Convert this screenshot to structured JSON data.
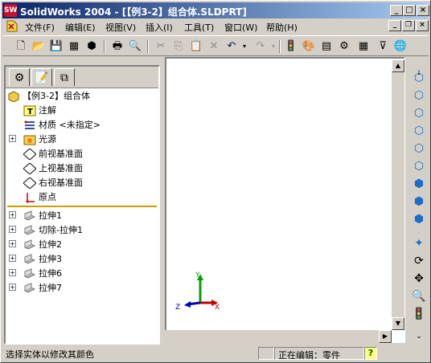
{
  "window": {
    "title": "SolidWorks 2004 - [【例3-2】组合体.SLDPRT]",
    "app_icon_label": "SW",
    "controls": {
      "minimize": "_",
      "maximize": "□",
      "close": "×"
    }
  },
  "menu": {
    "items": [
      "文件(F)",
      "编辑(E)",
      "视图(V)",
      "插入(I)",
      "工具(T)",
      "窗口(W)",
      "帮助(H)"
    ],
    "doc_controls": {
      "minimize": "_",
      "restore": "❐",
      "close": "×"
    }
  },
  "toolbar": {
    "icons": [
      "new-icon",
      "open-icon",
      "save-icon",
      "make-drawing-icon",
      "make-assembly-icon",
      "print-icon",
      "print-preview-icon",
      "cut-icon",
      "copy-icon",
      "paste-icon",
      "delete-icon",
      "undo-icon",
      "redo-icon",
      "traffic-light-icon",
      "edit-color-icon",
      "appearance-icon",
      "grid-icon",
      "options-icon",
      "web-icon"
    ]
  },
  "feature_manager": {
    "tabs": [
      "feature-manager-tab",
      "property-manager-tab",
      "configuration-manager-tab"
    ],
    "root": "【例3-2】组合体",
    "nodes": [
      {
        "label": "注解",
        "icon": "annotation-icon",
        "expand": false
      },
      {
        "label": "材质 <未指定>",
        "icon": "material-icon",
        "expand": false
      },
      {
        "label": "光源",
        "icon": "lighting-icon",
        "expand": true
      },
      {
        "label": "前视基准面",
        "icon": "plane-icon",
        "expand": false
      },
      {
        "label": "上视基准面",
        "icon": "plane-icon",
        "expand": false
      },
      {
        "label": "右视基准面",
        "icon": "plane-icon",
        "expand": false
      },
      {
        "label": "原点",
        "icon": "origin-icon",
        "expand": false
      }
    ],
    "features": [
      {
        "label": "拉伸1",
        "icon": "extrude-icon"
      },
      {
        "label": "切除-拉伸1",
        "icon": "cut-extrude-icon"
      },
      {
        "label": "拉伸2",
        "icon": "extrude-icon"
      },
      {
        "label": "拉伸3",
        "icon": "extrude-icon"
      },
      {
        "label": "拉伸6",
        "icon": "extrude-icon"
      },
      {
        "label": "拉伸7",
        "icon": "extrude-icon"
      }
    ]
  },
  "triad": {
    "x": "X",
    "y": "Y",
    "z": "Z"
  },
  "status": {
    "message": "选择实体以修改其颜色",
    "mode": "正在编辑：零件",
    "help": "?"
  }
}
